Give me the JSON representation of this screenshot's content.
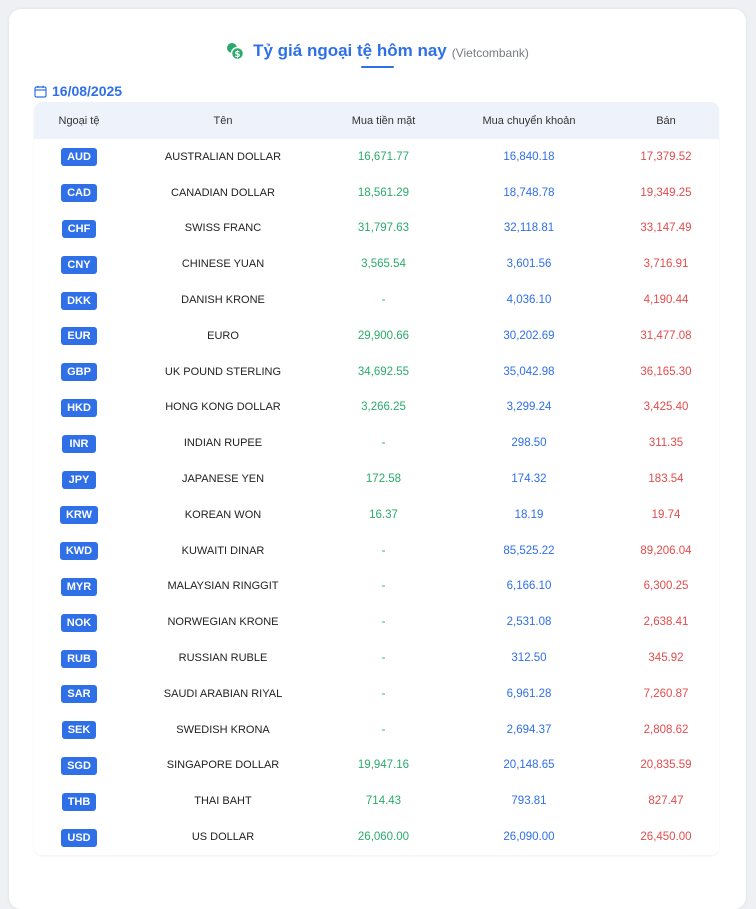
{
  "header": {
    "title": "Tỷ giá ngoại tệ hôm nay",
    "subtitle": "(Vietcombank)",
    "date": "16/08/2025"
  },
  "colors": {
    "accent": "#2f6fe8",
    "cash": "#2aaa6b",
    "sell": "#e24c4c"
  },
  "icons": {
    "title": "currency-exchange-icon",
    "date": "calendar-icon"
  },
  "table": {
    "columns": [
      "Ngoại tệ",
      "Tên",
      "Mua tiền mặt",
      "Mua chuyển khoản",
      "Bán"
    ],
    "rows": [
      {
        "code": "AUD",
        "name": "AUSTRALIAN DOLLAR",
        "cash": "16,671.77",
        "transfer": "16,840.18",
        "sell": "17,379.52"
      },
      {
        "code": "CAD",
        "name": "CANADIAN DOLLAR",
        "cash": "18,561.29",
        "transfer": "18,748.78",
        "sell": "19,349.25"
      },
      {
        "code": "CHF",
        "name": "SWISS FRANC",
        "cash": "31,797.63",
        "transfer": "32,118.81",
        "sell": "33,147.49"
      },
      {
        "code": "CNY",
        "name": "CHINESE YUAN",
        "cash": "3,565.54",
        "transfer": "3,601.56",
        "sell": "3,716.91"
      },
      {
        "code": "DKK",
        "name": "DANISH KRONE",
        "cash": "-",
        "transfer": "4,036.10",
        "sell": "4,190.44"
      },
      {
        "code": "EUR",
        "name": "EURO",
        "cash": "29,900.66",
        "transfer": "30,202.69",
        "sell": "31,477.08"
      },
      {
        "code": "GBP",
        "name": "UK POUND STERLING",
        "cash": "34,692.55",
        "transfer": "35,042.98",
        "sell": "36,165.30"
      },
      {
        "code": "HKD",
        "name": "HONG KONG DOLLAR",
        "cash": "3,266.25",
        "transfer": "3,299.24",
        "sell": "3,425.40"
      },
      {
        "code": "INR",
        "name": "INDIAN RUPEE",
        "cash": "-",
        "transfer": "298.50",
        "sell": "311.35"
      },
      {
        "code": "JPY",
        "name": "JAPANESE YEN",
        "cash": "172.58",
        "transfer": "174.32",
        "sell": "183.54"
      },
      {
        "code": "KRW",
        "name": "KOREAN WON",
        "cash": "16.37",
        "transfer": "18.19",
        "sell": "19.74"
      },
      {
        "code": "KWD",
        "name": "KUWAITI DINAR",
        "cash": "-",
        "transfer": "85,525.22",
        "sell": "89,206.04"
      },
      {
        "code": "MYR",
        "name": "MALAYSIAN RINGGIT",
        "cash": "-",
        "transfer": "6,166.10",
        "sell": "6,300.25"
      },
      {
        "code": "NOK",
        "name": "NORWEGIAN KRONE",
        "cash": "-",
        "transfer": "2,531.08",
        "sell": "2,638.41"
      },
      {
        "code": "RUB",
        "name": "RUSSIAN RUBLE",
        "cash": "-",
        "transfer": "312.50",
        "sell": "345.92"
      },
      {
        "code": "SAR",
        "name": "SAUDI ARABIAN RIYAL",
        "cash": "-",
        "transfer": "6,961.28",
        "sell": "7,260.87"
      },
      {
        "code": "SEK",
        "name": "SWEDISH KRONA",
        "cash": "-",
        "transfer": "2,694.37",
        "sell": "2,808.62"
      },
      {
        "code": "SGD",
        "name": "SINGAPORE DOLLAR",
        "cash": "19,947.16",
        "transfer": "20,148.65",
        "sell": "20,835.59"
      },
      {
        "code": "THB",
        "name": "THAI BAHT",
        "cash": "714.43",
        "transfer": "793.81",
        "sell": "827.47"
      },
      {
        "code": "USD",
        "name": "US DOLLAR",
        "cash": "26,060.00",
        "transfer": "26,090.00",
        "sell": "26,450.00"
      }
    ]
  }
}
